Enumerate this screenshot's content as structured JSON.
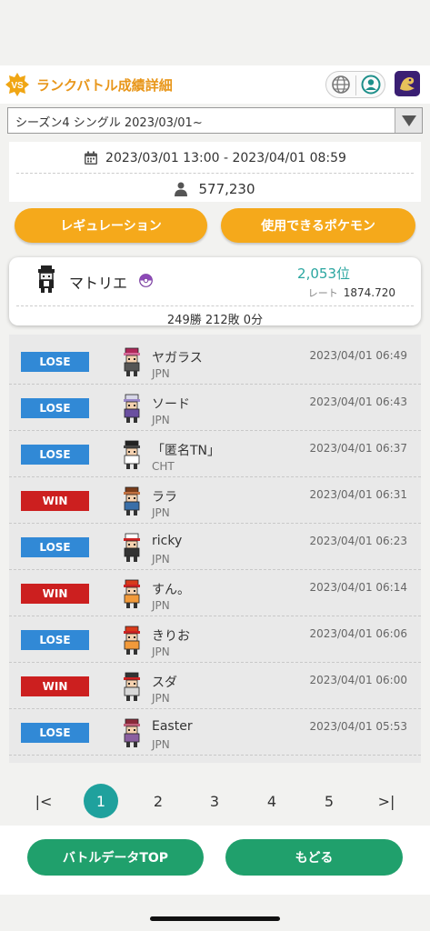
{
  "header": {
    "badge": "VS",
    "title": "ランクバトル成績詳細",
    "colors": {
      "title": "#e8961a",
      "logo_bg": "#3a1f73"
    }
  },
  "season": {
    "selected": "シーズン4 シングル 2023/03/01~"
  },
  "period": {
    "range": "2023/03/01 13:00 - 2023/04/01 08:59",
    "player_count": "577,230"
  },
  "buttons": {
    "regulation": "レギュレーション",
    "usable_pokemon": "使用できるポケモン",
    "battle_data_top": "バトルデータTOP",
    "back": "もどる"
  },
  "profile": {
    "name": "マトリエ",
    "rank": "2,053位",
    "rate_label": "レート",
    "rate_value": "1874.720",
    "record": "249勝 212敗 0分"
  },
  "battles": [
    {
      "result": "LOSE",
      "name": "ヤガラス",
      "country": "JPN",
      "time": "2023/04/01 06:49",
      "sprite": "trainer-pink-hair"
    },
    {
      "result": "LOSE",
      "name": "ソード",
      "country": "JPN",
      "time": "2023/04/01 06:43",
      "sprite": "trainer-white-hair"
    },
    {
      "result": "LOSE",
      "name": "「匿名TN」",
      "country": "CHT",
      "time": "2023/04/01 06:37",
      "sprite": "trainer-black-white"
    },
    {
      "result": "WIN",
      "name": "ララ",
      "country": "JPN",
      "time": "2023/04/01 06:31",
      "sprite": "trainer-brown-hair"
    },
    {
      "result": "LOSE",
      "name": "ricky",
      "country": "JPN",
      "time": "2023/04/01 06:23",
      "sprite": "trainer-white-cap"
    },
    {
      "result": "WIN",
      "name": "すん。",
      "country": "JPN",
      "time": "2023/04/01 06:14",
      "sprite": "trainer-red-cap"
    },
    {
      "result": "LOSE",
      "name": "きりお",
      "country": "JPN",
      "time": "2023/04/01 06:06",
      "sprite": "trainer-red-cap"
    },
    {
      "result": "WIN",
      "name": "スダ",
      "country": "JPN",
      "time": "2023/04/01 06:00",
      "sprite": "trainer-dark-cap"
    },
    {
      "result": "LOSE",
      "name": "Easter",
      "country": "JPN",
      "time": "2023/04/01 05:53",
      "sprite": "trainer-red-hair"
    }
  ],
  "pagination": {
    "first": "|<",
    "last": ">|",
    "pages": [
      "1",
      "2",
      "3",
      "4",
      "5"
    ],
    "current": "1"
  },
  "colors": {
    "orange": "#f5a91b",
    "teal": "#1fa19d",
    "green": "#20a06c",
    "lose": "#3189d6",
    "win": "#cc1f1f"
  }
}
